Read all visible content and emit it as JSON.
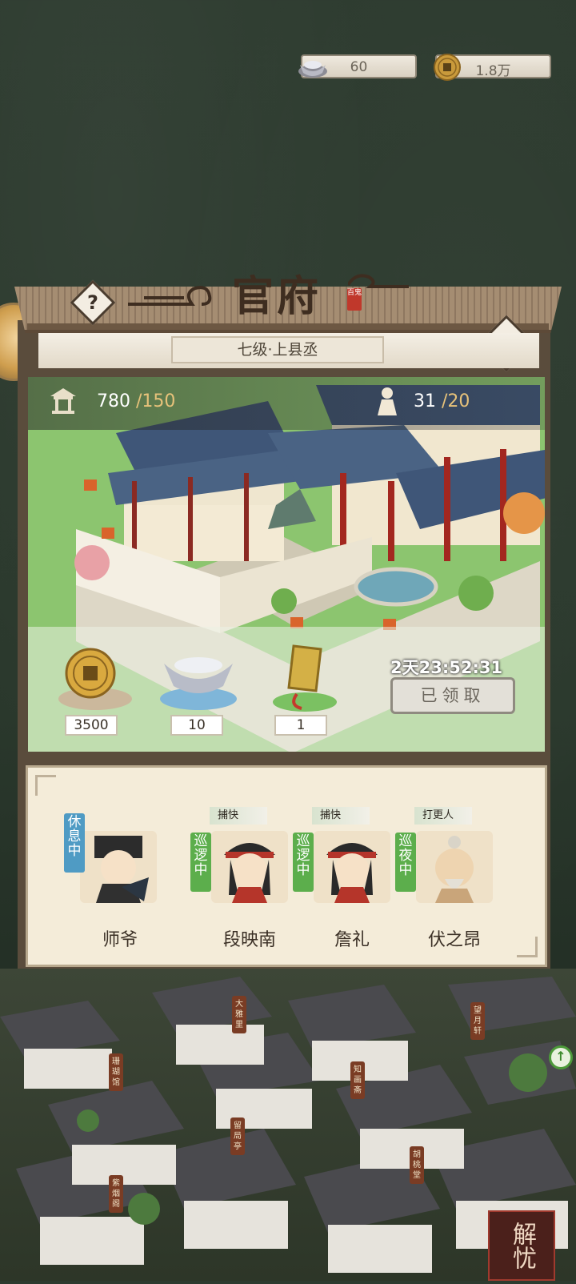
{
  "currencies": {
    "silver_ingot": "60",
    "copper_coin": "1.8万"
  },
  "building": {
    "title": "官府",
    "seal_text": "百鬼",
    "level": "七级·上县丞",
    "capacity_current": "780",
    "capacity_max": " /150",
    "staff_current": "31",
    "staff_max": " /20"
  },
  "rewards": [
    {
      "icon": "copper-coin-icon",
      "count": "3500"
    },
    {
      "icon": "silver-ingot-icon",
      "count": "10"
    },
    {
      "icon": "gold-token-icon",
      "count": "1"
    }
  ],
  "timer": "2天23:52:31",
  "claim_button": "已领取",
  "staff": [
    {
      "name": "师爷",
      "status": "休息中",
      "role": "",
      "status_color": "#4f9bc4"
    },
    {
      "name": "段映南",
      "status": "巡逻中",
      "role": "捕快",
      "status_color": "#5cae4c"
    },
    {
      "name": "詹礼",
      "status": "巡逻中",
      "role": "捕快",
      "status_color": "#5cae4c"
    },
    {
      "name": "伏之昂",
      "status": "巡夜中",
      "role": "打更人",
      "status_color": "#5cae4c"
    }
  ],
  "town_signs": [
    "大雅里",
    "望月轩",
    "珊瑚馆",
    "知画斋",
    "留局亭",
    "紫烟阁",
    "胡桃堂"
  ],
  "bottom_button": "解忧"
}
